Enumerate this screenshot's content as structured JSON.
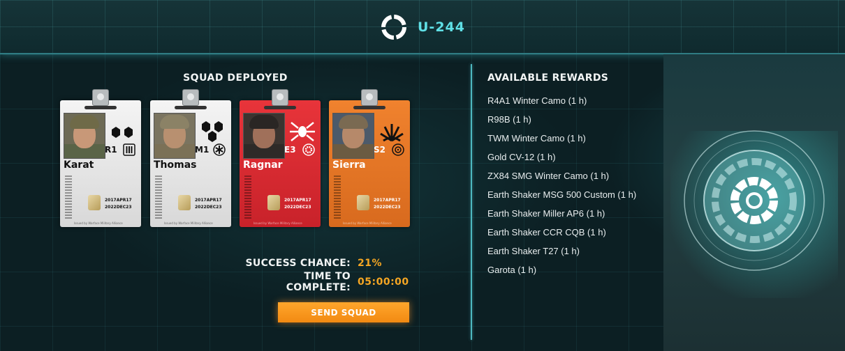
{
  "header": {
    "mission_name": "U-244"
  },
  "squad": {
    "title": "SQUAD DEPLOYED",
    "members": [
      {
        "name": "Karat",
        "rank_code": "R1",
        "card_color": "white",
        "issue_date": "2017APR17",
        "expiry_date": "2022DEC23"
      },
      {
        "name": "Thomas",
        "rank_code": "M1",
        "card_color": "white",
        "issue_date": "2017APR17",
        "expiry_date": "2022DEC23"
      },
      {
        "name": "Ragnar",
        "rank_code": "E3",
        "card_color": "red",
        "issue_date": "2017APR17",
        "expiry_date": "2022DEC23"
      },
      {
        "name": "Sierra",
        "rank_code": "S2",
        "card_color": "orange",
        "issue_date": "2017APR17",
        "expiry_date": "2022DEC23"
      }
    ],
    "issued_by": "Issued by Warface Military Alliance"
  },
  "stats": {
    "success_label": "SUCCESS CHANCE:",
    "success_value": "21%",
    "time_label": "TIME TO COMPLETE:",
    "time_value": "05:00:00"
  },
  "actions": {
    "send_label": "SEND SQUAD"
  },
  "rewards": {
    "title": "AVAILABLE REWARDS",
    "items": [
      "R4A1 Winter Camo (1 h)",
      "R98B (1 h)",
      "TWM Winter Camo (1 h)",
      "Gold CV-12 (1 h)",
      "ZX84 SMG Winter Camo (1 h)",
      "Earth Shaker MSG 500 Custom (1 h)",
      "Earth Shaker Miller AP6 (1 h)",
      "Earth Shaker CCR CQB (1 h)",
      "Earth Shaker T27 (1 h)",
      "Garota (1 h)"
    ]
  },
  "colors": {
    "accent": "#5fe0e6",
    "highlight": "#f5a623",
    "button": "#f59a1e",
    "red_card": "#d92b31",
    "orange_card": "#e57724"
  }
}
